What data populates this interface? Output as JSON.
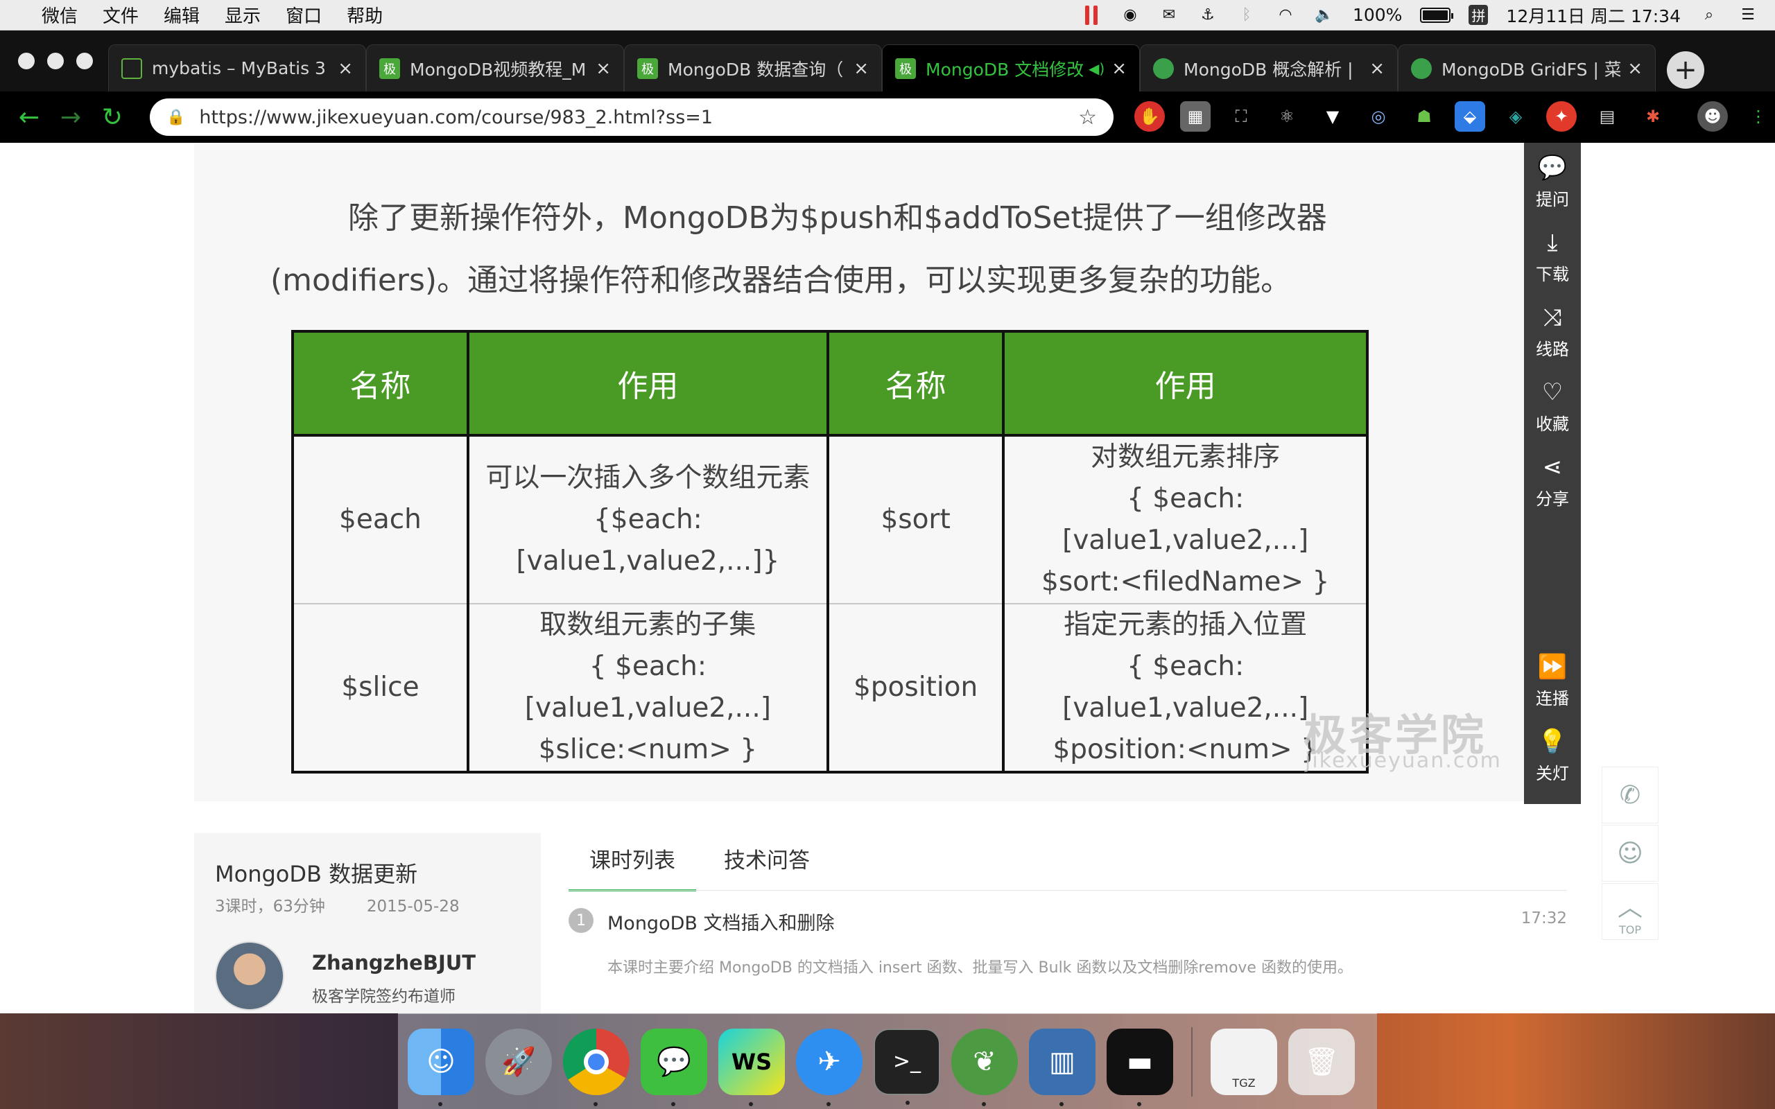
{
  "menubar": {
    "items": [
      "微信",
      "文件",
      "编辑",
      "显示",
      "窗口",
      "帮助"
    ],
    "battery": "100%",
    "ime": "拼",
    "datetime": "12月11日 周二 17:34"
  },
  "browser": {
    "tabs": [
      {
        "label": "mybatis – MyBatis 3 |",
        "favicon": "doc-icon",
        "active": false
      },
      {
        "label": "MongoDB视频教程_M",
        "favicon": "jk-icon",
        "active": false
      },
      {
        "label": "MongoDB 数据查询（",
        "favicon": "jk-icon",
        "active": false
      },
      {
        "label": "MongoDB 文档修改",
        "favicon": "jk-icon",
        "active": true
      },
      {
        "label": "MongoDB 概念解析 |",
        "favicon": "runoob-icon",
        "active": false
      },
      {
        "label": "MongoDB GridFS | 菜",
        "favicon": "runoob-icon",
        "active": false
      }
    ],
    "url": "https://www.jikexueyuan.com/course/983_2.html?ss=1",
    "favicon_text": "极"
  },
  "slide": {
    "paragraph_line1": "除了更新操作符外，MongoDB为$push和$addToSet提供了一组修改器",
    "paragraph_line2": "(modifiers)。通过将操作符和修改器结合使用，可以实现更多复杂的功能。",
    "headers": [
      "名称",
      "作用",
      "名称",
      "作用"
    ],
    "rows": [
      {
        "name1": "$each",
        "desc1": [
          "可以一次插入多个数组元素",
          "{$each: [value1,value2,...]}"
        ],
        "name2": "$sort",
        "desc2": [
          "对数组元素排序",
          "{ $each: [value1,value2,...]",
          "$sort:<filedName> }"
        ]
      },
      {
        "name1": "$slice",
        "desc1": [
          "取数组元素的子集",
          "{ $each: [value1,value2,...]",
          "$slice:<num> }"
        ],
        "name2": "$position",
        "desc2": [
          "指定元素的插入位置",
          "{ $each: [value1,value2,...]",
          "$position:<num> }"
        ]
      }
    ],
    "watermark": "极客学院",
    "watermark_sub": "jikexueyuan.com",
    "header_color": "#4a9a26"
  },
  "side_panel": {
    "items": [
      "提问",
      "下载",
      "线路",
      "收藏",
      "分享"
    ],
    "bottom_items": [
      "连播",
      "关灯"
    ]
  },
  "float_tools": {
    "top_label": "TOP"
  },
  "course": {
    "title": "MongoDB 数据更新",
    "meta": "3课时，63分钟",
    "date": "2015-05-28",
    "author": "ZhangzheBJUT",
    "author_role": "极客学院签约布道师"
  },
  "lessons": {
    "tabs": [
      "课时列表",
      "技术问答"
    ],
    "items": [
      {
        "num": "1",
        "name": "MongoDB 文档插入和删除",
        "duration": "17:32",
        "desc": "本课时主要介绍 MongoDB 的文档插入 insert 函数、批量写入 Bulk 函数以及文档删除remove 函数的使用。"
      }
    ]
  },
  "dock": {
    "tgz_label": "TGZ"
  }
}
